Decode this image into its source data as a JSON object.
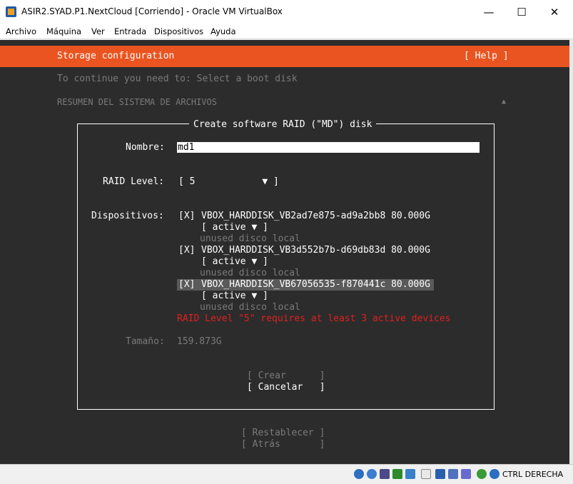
{
  "window": {
    "title": "ASIR2.SYAD.P1.NextCloud [Corriendo] - Oracle VM VirtualBox",
    "minimize": "—",
    "maximize": "☐",
    "close": "✕"
  },
  "menu": [
    "Archivo",
    "Máquina",
    "Ver",
    "Entrada",
    "Dispositivos",
    "Ayuda"
  ],
  "installer": {
    "header_title": "Storage configuration",
    "help": "[ Help ]",
    "instruction": "To continue you need to: Select a boot disk",
    "section": "RESUMEN DEL SISTEMA DE ARCHIVOS",
    "scroll_arrow": "▲"
  },
  "dialog": {
    "title": "Create software RAID (\"MD\") disk",
    "name_label": "Nombre:",
    "name_value": "md1",
    "raid_label": "RAID Level:",
    "raid_value": "[ 5            ▼ ]",
    "devices_label": "Dispositivos:",
    "devices": [
      {
        "check": "[X]",
        "name": "VBOX_HARDDISK_VB2ad7e875-ad9a2bb8 80.000G",
        "status": "[ active ▼ ]",
        "desc": "unused disco local"
      },
      {
        "check": "[X]",
        "name": "VBOX_HARDDISK_VB3d552b7b-d69db83d 80.000G",
        "status": "[ active ▼ ]",
        "desc": "unused disco local"
      },
      {
        "check": "[X]",
        "name": "VBOX_HARDDISK_VB67056535-f870441c 80.000G",
        "status": "[ active ▼ ]",
        "desc": "unused disco local"
      }
    ],
    "error": "RAID Level \"5\" requires at least 3 active devices",
    "size_label": "Tamaño:",
    "size_value": "159.873G",
    "create": "[ Crear      ]",
    "cancel": "[ Cancelar   ]"
  },
  "bottom_buttons": {
    "reset": "[ Restablecer ]",
    "back": "[ Atrás       ]"
  },
  "status": {
    "host_key": "CTRL DERECHA"
  }
}
